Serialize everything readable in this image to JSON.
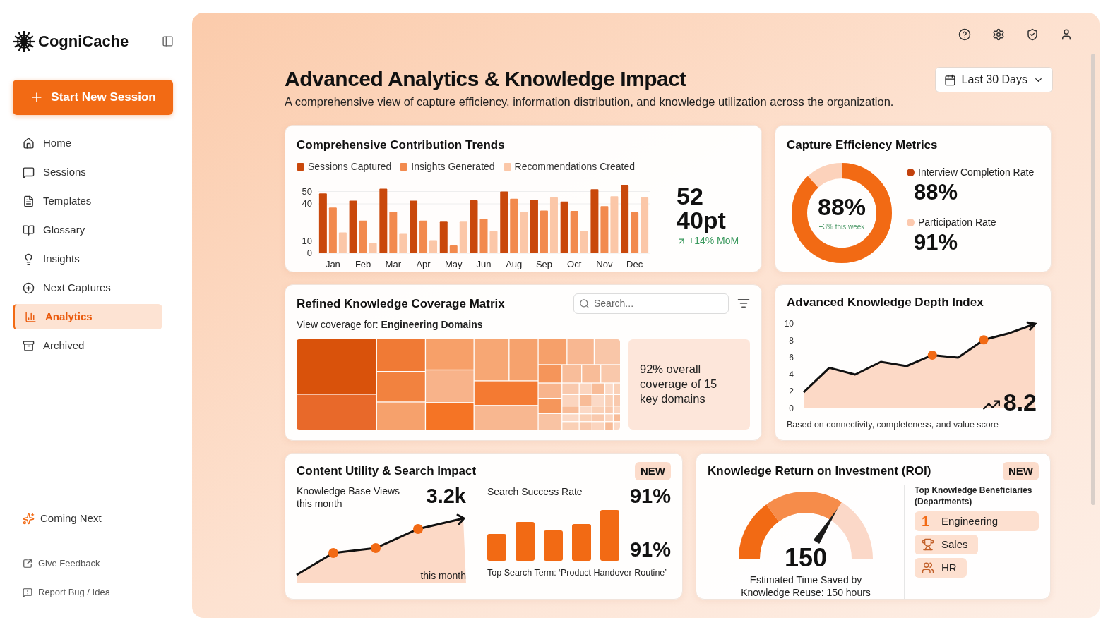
{
  "sidebar": {
    "brand": "CogniCache",
    "new_session": "Start New Session",
    "items": [
      {
        "label": "Home",
        "selected": false
      },
      {
        "label": "Sessions",
        "selected": false
      },
      {
        "label": "Templates",
        "selected": false
      },
      {
        "label": "Glossary",
        "selected": false
      },
      {
        "label": "Insights",
        "selected": false
      },
      {
        "label": "Next Captures",
        "selected": false
      },
      {
        "label": "Analytics",
        "selected": true
      },
      {
        "label": "Archived",
        "selected": false
      }
    ],
    "coming_next": "Coming Next",
    "links": [
      "Give Feedback",
      "Report Bug / Idea"
    ]
  },
  "header": {
    "title": "Advanced Analytics & Knowledge Impact",
    "subtitle": "A comprehensive view of capture efficiency, information distribution, and knowledge utilization across the organization.",
    "date_range": "Last 30 Days"
  },
  "contribution_trends": {
    "title": "Comprehensive Contribution Trends",
    "chart_data": {
      "type": "bar",
      "categories": [
        "Jan",
        "Feb",
        "Mar",
        "Apr",
        "May",
        "Jun",
        "Aug",
        "Sep",
        "Oct",
        "Nov",
        "Dec"
      ],
      "series": [
        {
          "name": "Sessions Captured",
          "color": "#c9480b",
          "values": [
            48.4,
            42.6,
            52.3,
            42.6,
            25.6,
            42.9,
            50,
            43.4,
            41.9,
            51.8,
            55.5
          ]
        },
        {
          "name": "Insights Generated",
          "color": "#f28a4e",
          "values": [
            37,
            26.5,
            33.7,
            26.5,
            6.3,
            28,
            44.2,
            34.6,
            34.3,
            38.2,
            33.1
          ]
        },
        {
          "name": "Recommendations Created",
          "color": "#fbc7a8",
          "values": [
            16.9,
            8.2,
            15.7,
            10.6,
            25.6,
            17.8,
            33.7,
            45.3,
            17.8,
            46.1,
            45.3
          ]
        }
      ],
      "ylim": [
        0,
        56
      ],
      "yticks": [
        0,
        10,
        40,
        50
      ],
      "grid": true
    },
    "stat_value": "52",
    "stat_secondary": "40pt",
    "change": "+14% MoM"
  },
  "capture_efficiency": {
    "title": "Capture Efficiency Metrics",
    "donut": {
      "value": "88%",
      "change": "+3% this week"
    },
    "metrics": [
      {
        "label": "Interview Completion Rate",
        "value": "88%",
        "color": "#c2410c"
      },
      {
        "label": "Participation Rate",
        "value": "91%",
        "color": "#fcc9ae"
      }
    ]
  },
  "coverage_matrix": {
    "title": "Refined Knowledge Coverage Matrix",
    "search": {
      "placeholder": "Search..."
    },
    "view_for": "View coverage for: **Engineering Domains**",
    "summary": "92% overall coverage of 15 key domains"
  },
  "depth_index": {
    "title": "Advanced Knowledge Depth Index",
    "chart_data": {
      "type": "area",
      "series": [
        {
          "color": "#111111",
          "values": [
            1.9,
            4.8,
            4.0,
            5.5,
            5.0,
            6.3,
            6.0,
            8.1,
            8.9,
            10
          ]
        }
      ],
      "ylim": [
        0,
        10
      ],
      "yticks": [
        0,
        2,
        4,
        6,
        8,
        10
      ]
    },
    "score": "8.2",
    "note": "Based on connectivity, completeness, and value score"
  },
  "content_utility": {
    "title": "Content Utility & Search Impact",
    "badge": "NEW",
    "views": {
      "label": "Knowledge Base Views this month",
      "value": "3.2k",
      "caption": "this month"
    },
    "search": {
      "label": "Search Success Rate",
      "value": "91%",
      "value_repeat": "91%",
      "top_term": "Top Search Term: ‘Product Handover Routine’"
    }
  },
  "roi": {
    "title": "Knowledge Return on Investment (ROI)",
    "badge": "NEW",
    "gauge": {
      "value": "150"
    },
    "caption": "Estimated Time Saved by Knowledge Reuse: 150 hours",
    "beneficiaries": {
      "title": "Top Knowledge Beneficiaries (Departments)",
      "items": [
        {
          "kind": "rank",
          "rank": "1",
          "label": "Engineering"
        },
        {
          "kind": "trophy",
          "label": "Sales"
        },
        {
          "kind": "people",
          "label": "HR"
        }
      ]
    }
  }
}
